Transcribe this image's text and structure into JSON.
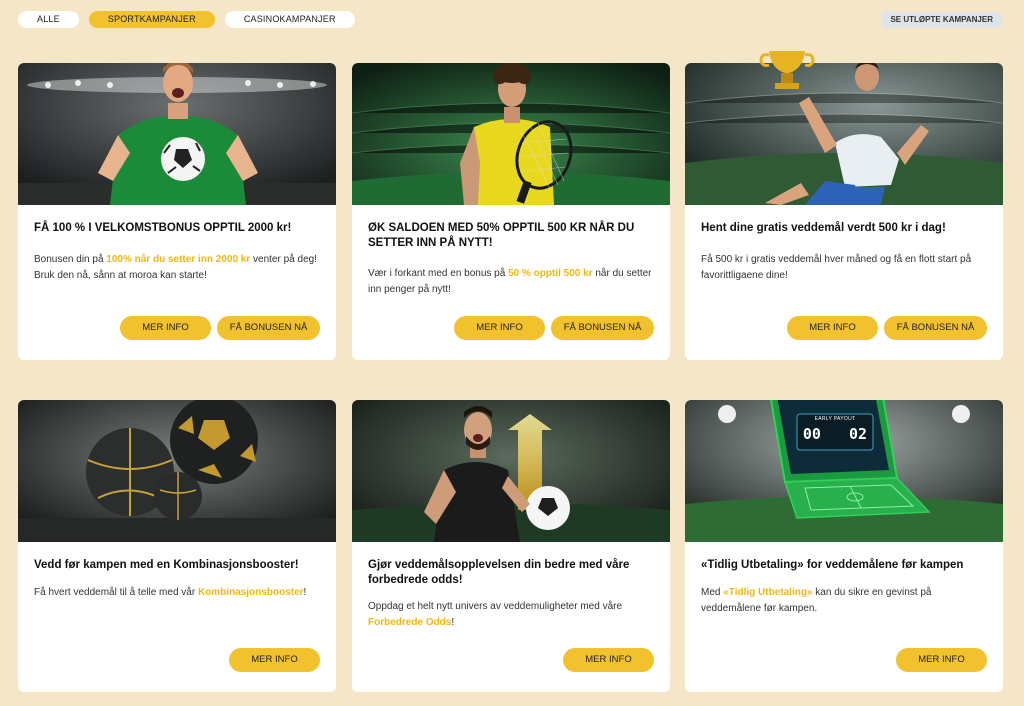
{
  "filters": {
    "all": "ALLE",
    "sport": "SPORTKAMPANJER",
    "casino": "CASINOKAMPANJER",
    "expired": "SE UTLØPTE KAMPANJER"
  },
  "buttons": {
    "info": "MER INFO",
    "bonus": "FÅ BONUSEN NÅ"
  },
  "cards": [
    {
      "title": "FÅ 100 % I VELKOMSTBONUS OPPTIL 2000 kr!",
      "desc_a": "Bonusen din på ",
      "desc_hl": "100% når du setter inn 2000 kr",
      "desc_b": " venter på deg! Bruk den nå, sånn at moroa kan starte!"
    },
    {
      "title": "ØK SALDOEN MED 50% OPPTIL 500 KR NÅR DU SETTER INN PÅ NYTT!",
      "desc_a": "Vær i forkant med en bonus på ",
      "desc_hl": "50 % opptil 500 kr",
      "desc_b": " når du setter inn penger på nytt!"
    },
    {
      "title": "Hent dine gratis veddemål verdt 500 kr i dag!",
      "desc_a": "Få 500 kr i gratis veddemål hver måned og få en flott start på favorittligaene dine!",
      "desc_hl": "",
      "desc_b": ""
    },
    {
      "title": "Vedd før kampen med en Kombinasjonsbooster!",
      "desc_a": "Få hvert veddemål til å telle med vår ",
      "desc_hl": "Kombinasjonsbooster",
      "desc_b": "!"
    },
    {
      "title": "Gjør veddemålsopplevelsen din bedre med våre forbedrede odds!",
      "desc_a": "Oppdag et helt nytt univers av veddemuligheter med våre ",
      "desc_hl": "Forbedrede Odds",
      "desc_b": "!"
    },
    {
      "title": "«Tidlig Utbetaling» for veddemålene før kampen",
      "desc_a": "Med ",
      "desc_hl": "«Tidlig Utbetaling»",
      "desc_b": " kan du sikre en gevinst på veddemålene før kampen."
    }
  ],
  "scoreboard": {
    "label": "EARLY PAYOUT",
    "home": "00",
    "away": "02"
  },
  "colors": {
    "accent": "#f2c12e",
    "background": "#f6e6c8"
  }
}
